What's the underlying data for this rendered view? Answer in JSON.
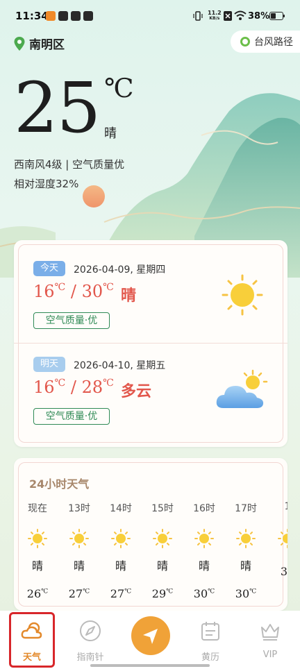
{
  "status_bar": {
    "time": "11:34",
    "net_speed_value": "11.2",
    "net_speed_unit": "KB/s",
    "battery": "38%"
  },
  "header": {
    "location": "南明区",
    "typhoon_button": "台风路径"
  },
  "current": {
    "temperature": "25",
    "unit": "℃",
    "condition": "晴",
    "wind_air": "西南风4级 | 空气质量优",
    "humidity": "相对湿度32%"
  },
  "days": [
    {
      "tag": "今天",
      "tag_color": "#7aaee8",
      "date": "2026-04-09,  星期四",
      "low": "16",
      "high": "30",
      "unit": "℃",
      "sep": " / ",
      "condition": "晴",
      "air_quality": "空气质量·优",
      "icon": "sun-icon"
    },
    {
      "tag": "明天",
      "tag_color": "#a8cdee",
      "date": "2026-04-10,  星期五",
      "low": "16",
      "high": "28",
      "unit": "℃",
      "sep": " / ",
      "condition": "多云",
      "air_quality": "空气质量·优",
      "icon": "partly-cloudy-icon"
    }
  ],
  "hourly": {
    "title": "24小时天气",
    "unit": "℃",
    "items": [
      {
        "hour": "现在",
        "condition": "晴",
        "temp": "26",
        "icon": "sun-icon"
      },
      {
        "hour": "13时",
        "condition": "晴",
        "temp": "27",
        "icon": "sun-icon"
      },
      {
        "hour": "14时",
        "condition": "晴",
        "temp": "27",
        "icon": "sun-icon"
      },
      {
        "hour": "15时",
        "condition": "晴",
        "temp": "29",
        "icon": "sun-icon"
      },
      {
        "hour": "16时",
        "condition": "晴",
        "temp": "30",
        "icon": "sun-icon"
      },
      {
        "hour": "17时",
        "condition": "晴",
        "temp": "30",
        "icon": "sun-icon"
      },
      {
        "hour": "1",
        "condition": "",
        "temp": "3",
        "icon": "sun-icon"
      }
    ]
  },
  "nav": {
    "weather": "天气",
    "compass": "指南针",
    "almanac": "黄历",
    "vip": "VIP"
  },
  "colors": {
    "accent": "#e3892b",
    "temp_red": "#e2574c",
    "badge_green": "#2f8a55"
  }
}
